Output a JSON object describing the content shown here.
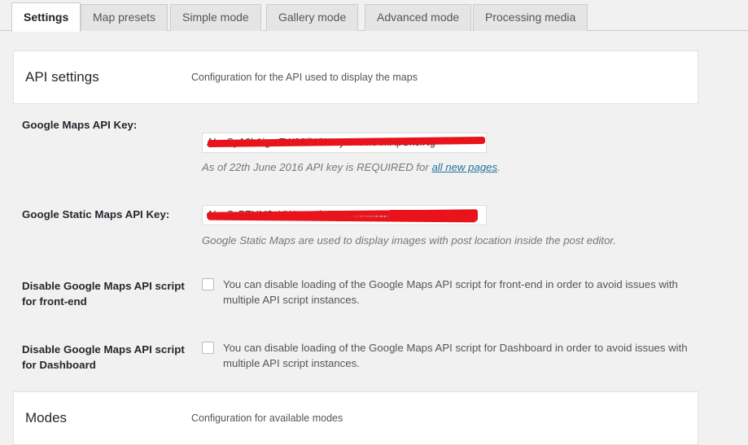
{
  "tabs": [
    {
      "label": "Settings",
      "active": true
    },
    {
      "label": "Map presets",
      "active": false
    },
    {
      "label": "Simple mode",
      "active": false
    },
    {
      "label": "Gallery mode",
      "active": false
    },
    {
      "label": "Advanced mode",
      "active": false
    },
    {
      "label": "Processing media",
      "active": false
    }
  ],
  "sections": {
    "api": {
      "title": "API settings",
      "description": "Configuration for the API used to display the maps"
    },
    "modes": {
      "title": "Modes",
      "description": "Configuration for available modes"
    }
  },
  "fields": {
    "maps_key": {
      "label": "Google Maps API Key:",
      "value": "AIzaSyA0kAigatFW6SiiWi0LayEHu0xAmXpGxcfNg",
      "redacted": true,
      "hint_before": "As of 22th June 2016 API key is REQUIRED for ",
      "hint_link": "all new pages",
      "hint_after": "."
    },
    "static_maps_key": {
      "label": "Google Static Maps API Key:",
      "value": "AIzaSyBTHM2qHWspm4jc6QS4cGmc8WdKU5uEw",
      "redacted": true,
      "hint": "Google Static Maps are used to display images with post location inside the post editor."
    },
    "disable_frontend": {
      "label": "Disable Google Maps API script for front-end",
      "checked": false,
      "description": "You can disable loading of the Google Maps API script for front-end in order to avoid issues with multiple API script instances."
    },
    "disable_dashboard": {
      "label": "Disable Google Maps API script for Dashboard",
      "checked": false,
      "description": "You can disable loading of the Google Maps API script for Dashboard in order to avoid issues with multiple API script instances."
    }
  },
  "colors": {
    "redaction": "#e8131b",
    "link": "#21759b",
    "background": "#f1f1f1",
    "panel": "#ffffff"
  }
}
